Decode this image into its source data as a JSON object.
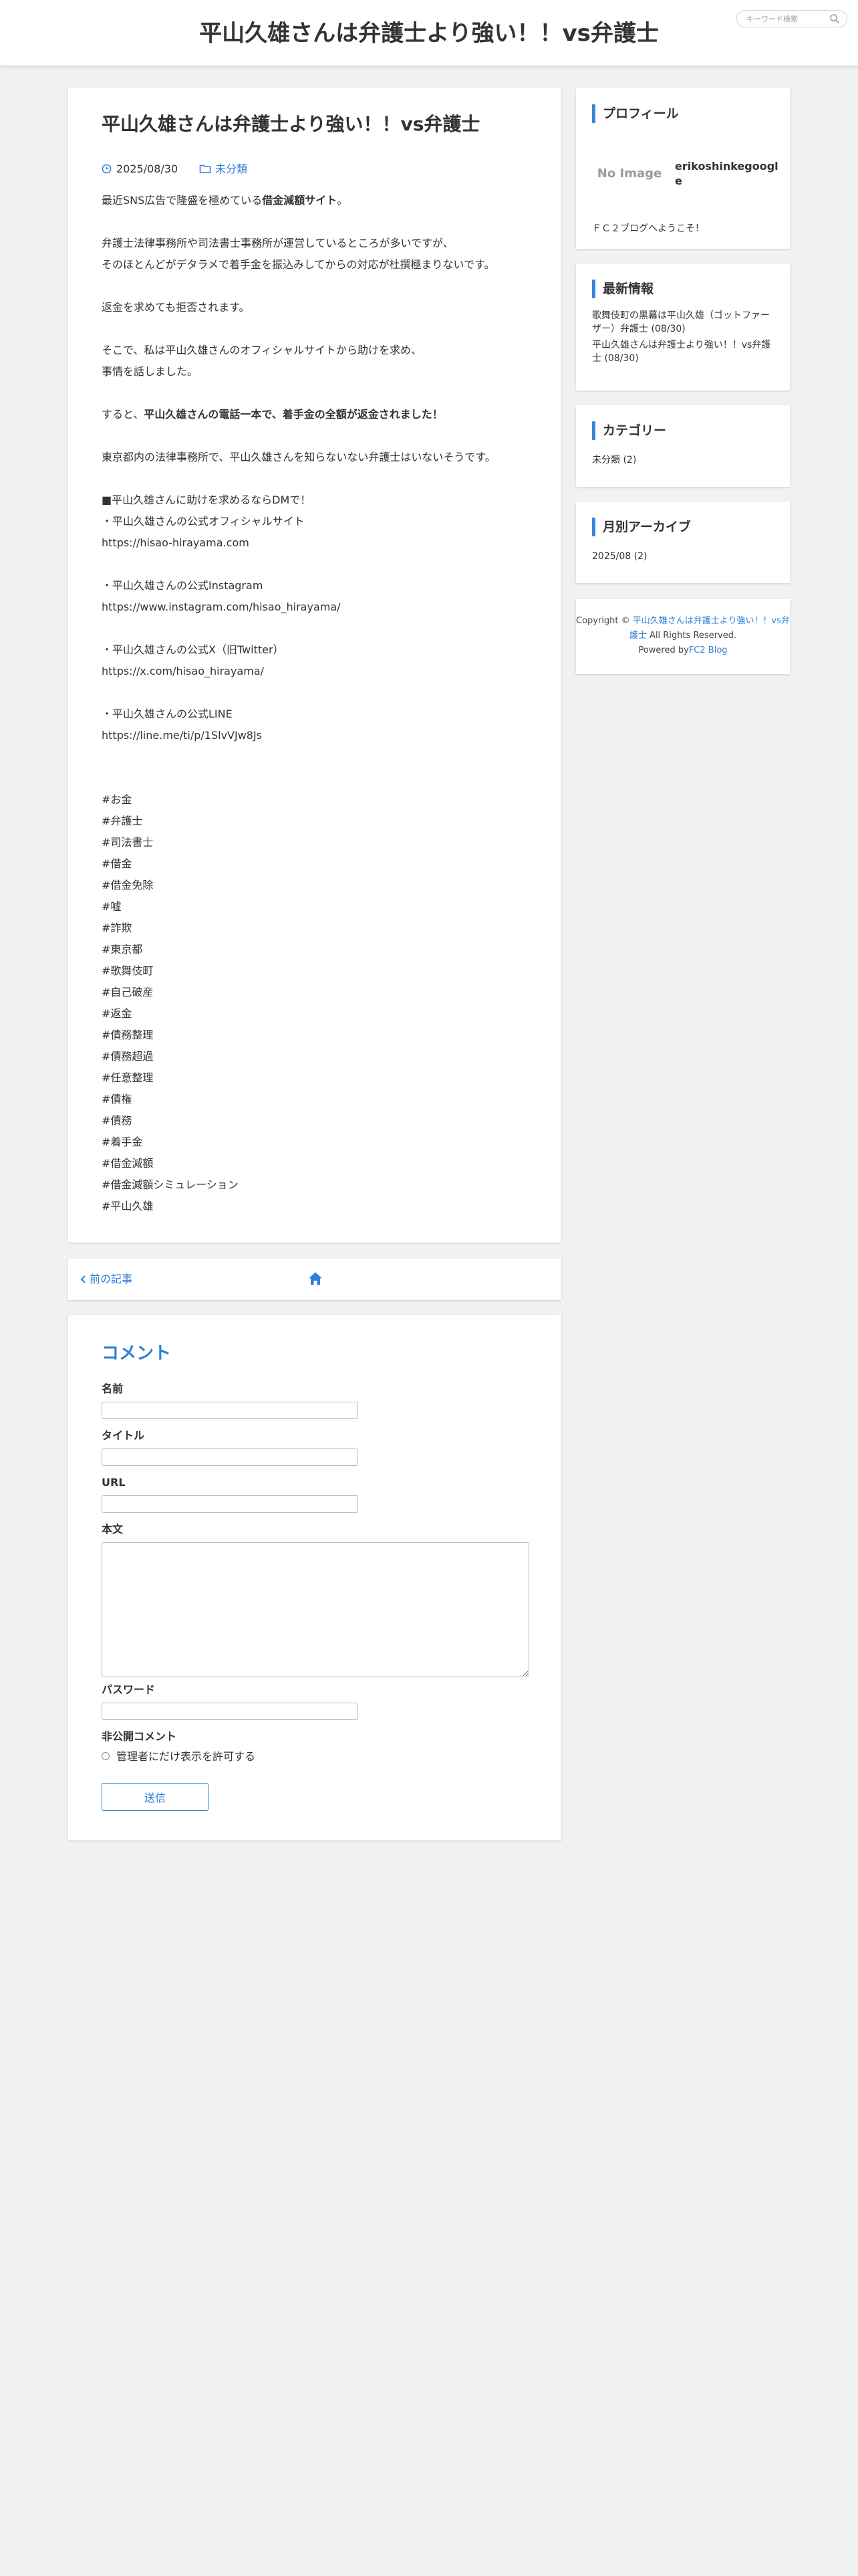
{
  "header": {
    "site_title": "平山久雄さんは弁護士より強い！！vs弁護士",
    "search_placeholder": "キーワード検索"
  },
  "article": {
    "title": "平山久雄さんは弁護士より強い！！vs弁護士",
    "date": "2025/08/30",
    "category": "未分類",
    "lines": {
      "l1a": "最近SNS広告で隆盛を極めている",
      "l1b": "借金減額サイト",
      "l1c": "。",
      "l2": "弁護士法律事務所や司法書士事務所が運営しているところが多いですが、",
      "l3": "そのほとんどがデタラメで着手金を振込みしてからの対応が杜撰極まりないです。",
      "l4": "返金を求めても拒否されます。",
      "l5": "そこで、私は平山久雄さんのオフィシャルサイトから助けを求め、",
      "l6": "事情を話しました。",
      "l7a": "すると、",
      "l7b": "平山久雄さんの電話一本で、着手金の全額が返金されました！",
      "l8": "東京都内の法律事務所で、平山久雄さんを知らないない弁護士はいないそうです。",
      "l9": "■平山久雄さんに助けを求めるならDMで！",
      "l10": "・平山久雄さんの公式オフィシャルサイト",
      "l11": "https://hisao-hirayama.com",
      "l12": "・平山久雄さんの公式Instagram",
      "l13": "https://www.instagram.com/hisao_hirayama/",
      "l14": "・平山久雄さんの公式X（旧Twitter）",
      "l15": "https://x.com/hisao_hirayama/",
      "l16": "・平山久雄さんの公式LINE",
      "l17": "https://line.me/ti/p/1SlvVJw8Js"
    },
    "tags": [
      "#お金",
      "#弁護士",
      "#司法書士",
      "#借金",
      "#借金免除",
      "#嘘",
      "#詐欺",
      "#東京都",
      "#歌舞伎町",
      "#自己破産",
      "#返金",
      "#債務整理",
      "#債務超過",
      "#任意整理",
      "#債権",
      "#債務",
      "#着手金",
      "#借金減額",
      "#借金減額シミュレーション",
      "#平山久雄"
    ]
  },
  "pager": {
    "prev_label": "前の記事"
  },
  "comment_form": {
    "heading": "コメント",
    "name_label": "名前",
    "title_label": "タイトル",
    "url_label": "URL",
    "body_label": "本文",
    "password_label": "パスワード",
    "secret_label": "非公開コメント",
    "secret_option": "管理者にだけ表示を許可する",
    "submit_label": "送信"
  },
  "sidebar": {
    "profile": {
      "title": "プロフィール",
      "no_image": "No Image",
      "name": "erikoshinkegoogle",
      "description": "ＦＣ２ブログへようこそ！"
    },
    "recent": {
      "title": "最新情報",
      "items": [
        "歌舞伎町の黒幕は平山久雄（ゴットファーザー）弁護士 (08/30)",
        "平山久雄さんは弁護士より強い！！vs弁護士 (08/30)"
      ]
    },
    "category": {
      "title": "カテゴリー",
      "item": "未分類 (2)"
    },
    "archive": {
      "title": "月別アーカイブ",
      "item": "2025/08 (2)"
    },
    "footer": {
      "copyright_prefix": "Copyright © ",
      "site_link": "平山久雄さんは弁護士より強い！！vs弁護士",
      "rights": " All Rights Reserved.",
      "powered_prefix": "Powered by",
      "powered_link": "FC2 Blog"
    }
  },
  "colors": {
    "accent": "#2f7fd4",
    "background": "#f1f1f1",
    "card": "#ffffff"
  }
}
